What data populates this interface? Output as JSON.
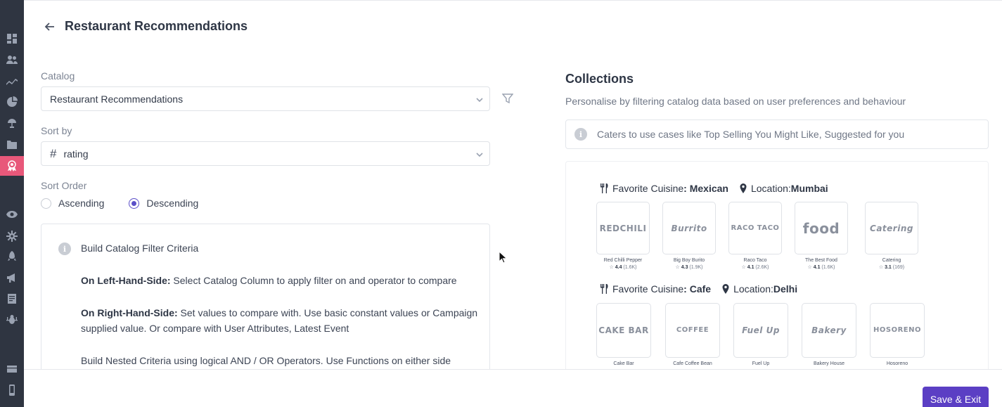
{
  "header": {
    "title": "Restaurant Recommendations"
  },
  "catalog": {
    "label": "Catalog",
    "value": "Restaurant Recommendations"
  },
  "sort_by": {
    "label": "Sort by",
    "value": "rating"
  },
  "sort_order": {
    "label": "Sort Order",
    "options": [
      "Ascending",
      "Descending"
    ],
    "selected": "Descending"
  },
  "criteria": {
    "title": "Build Catalog Filter Criteria",
    "lhs_label": "On Left-Hand-Side:",
    "lhs_text": " Select Catalog Column to apply filter on and operator to compare",
    "rhs_label": "On Right-Hand-Side:",
    "rhs_text": " Set values to compare with. Use basic constant values or Campaign supplied value. Or compare with User Attributes, Latest Event",
    "nested_text": "Build Nested Criteria using logical AND / OR Operators. Use Functions on either side"
  },
  "collections": {
    "title": "Collections",
    "subtitle": "Personalise by filtering catalog data based on user preferences and behaviour",
    "hint": "Caters to use cases like Top Selling You Might Like, Suggested for you"
  },
  "preview": {
    "groups": [
      {
        "cuisine_label": "Favorite Cuisine",
        "cuisine_value": ": Mexican",
        "location_label": "Location: ",
        "location_value": "Mumbai",
        "items": [
          {
            "logo": "REDCHILI",
            "name": "Red Chilli Pepper",
            "rating": "4.4",
            "count": "(1.6K)"
          },
          {
            "logo": "Burrito",
            "name": "Big Boy Burito",
            "rating": "4.3",
            "count": "(1.9K)"
          },
          {
            "logo": "RACO TACO",
            "name": "Raco Taco",
            "rating": "4.1",
            "count": "(2.6K)"
          },
          {
            "logo": "food",
            "name": "The Best Food",
            "rating": "4.1",
            "count": "(1.6K)"
          },
          {
            "logo": "Catering",
            "name": "Catering",
            "rating": "3.1",
            "count": "(169)"
          }
        ]
      },
      {
        "cuisine_label": "Favorite Cuisine",
        "cuisine_value": ": Cafe",
        "location_label": "Location: ",
        "location_value": "Delhi",
        "items": [
          {
            "logo": "CAKE BAR",
            "name": "Cake Bar"
          },
          {
            "logo": "COFFEE",
            "name": "Cafe Coffee Bean"
          },
          {
            "logo": "Fuel Up",
            "name": "Fuel Up"
          },
          {
            "logo": "Bakery",
            "name": "Bakery House"
          },
          {
            "logo": "HOSORENO",
            "name": "Hosoreno"
          }
        ]
      }
    ]
  },
  "footer": {
    "save_label": "Save & Exit"
  },
  "colors": {
    "accent": "#5b3fc4",
    "sidebar": "#2f3541",
    "sidebar_active": "#e8587a"
  },
  "sidebar": {
    "icons": [
      "dashboard-icon",
      "users-icon",
      "analytics-icon",
      "segments-icon",
      "campaigns-icon",
      "catalog-icon",
      "recommendations-icon",
      "eye-icon",
      "settings-gear-icon",
      "rocket-icon",
      "megaphone-icon",
      "reports-icon",
      "bug-icon",
      "inbox-icon",
      "device-icon"
    ]
  }
}
